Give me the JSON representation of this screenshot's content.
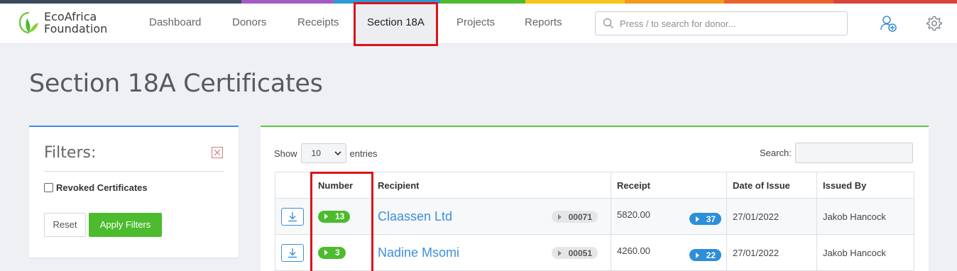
{
  "logo": {
    "line1": "EcoAfrica",
    "line2": "Foundation"
  },
  "nav": {
    "items": [
      {
        "label": "Dashboard"
      },
      {
        "label": "Donors"
      },
      {
        "label": "Receipts"
      },
      {
        "label": "Section 18A",
        "active": true
      },
      {
        "label": "Projects"
      },
      {
        "label": "Reports"
      }
    ],
    "search_placeholder": "Press / to search for donor...",
    "icons": [
      "add-user-icon",
      "gear-icon"
    ]
  },
  "page": {
    "title": "Section 18A Certificates"
  },
  "filters": {
    "title": "Filters:",
    "revoked_label": "Revoked Certificates",
    "reset_label": "Reset",
    "apply_label": "Apply Filters"
  },
  "table": {
    "show_label": "Show",
    "entries_value": "10",
    "entries_label": "entries",
    "search_label": "Search:",
    "headers": [
      "",
      "Number",
      "Recipient",
      "Receipt",
      "Date of Issue",
      "Issued By"
    ],
    "rows": [
      {
        "number": "13",
        "recipient": "Claassen Ltd",
        "donor_ref": "00071",
        "amount": "5820.00",
        "receipt_no": "37",
        "date": "27/01/2022",
        "issued_by": "Jakob Hancock"
      },
      {
        "number": "3",
        "recipient": "Nadine Msomi",
        "donor_ref": "00051",
        "amount": "4260.00",
        "receipt_no": "22",
        "date": "27/01/2022",
        "issued_by": "Jakob Hancock"
      }
    ]
  },
  "colors": {
    "brand_green": "#4cbb2e",
    "link_blue": "#3d8fd9",
    "highlight_red": "#d9141b"
  }
}
